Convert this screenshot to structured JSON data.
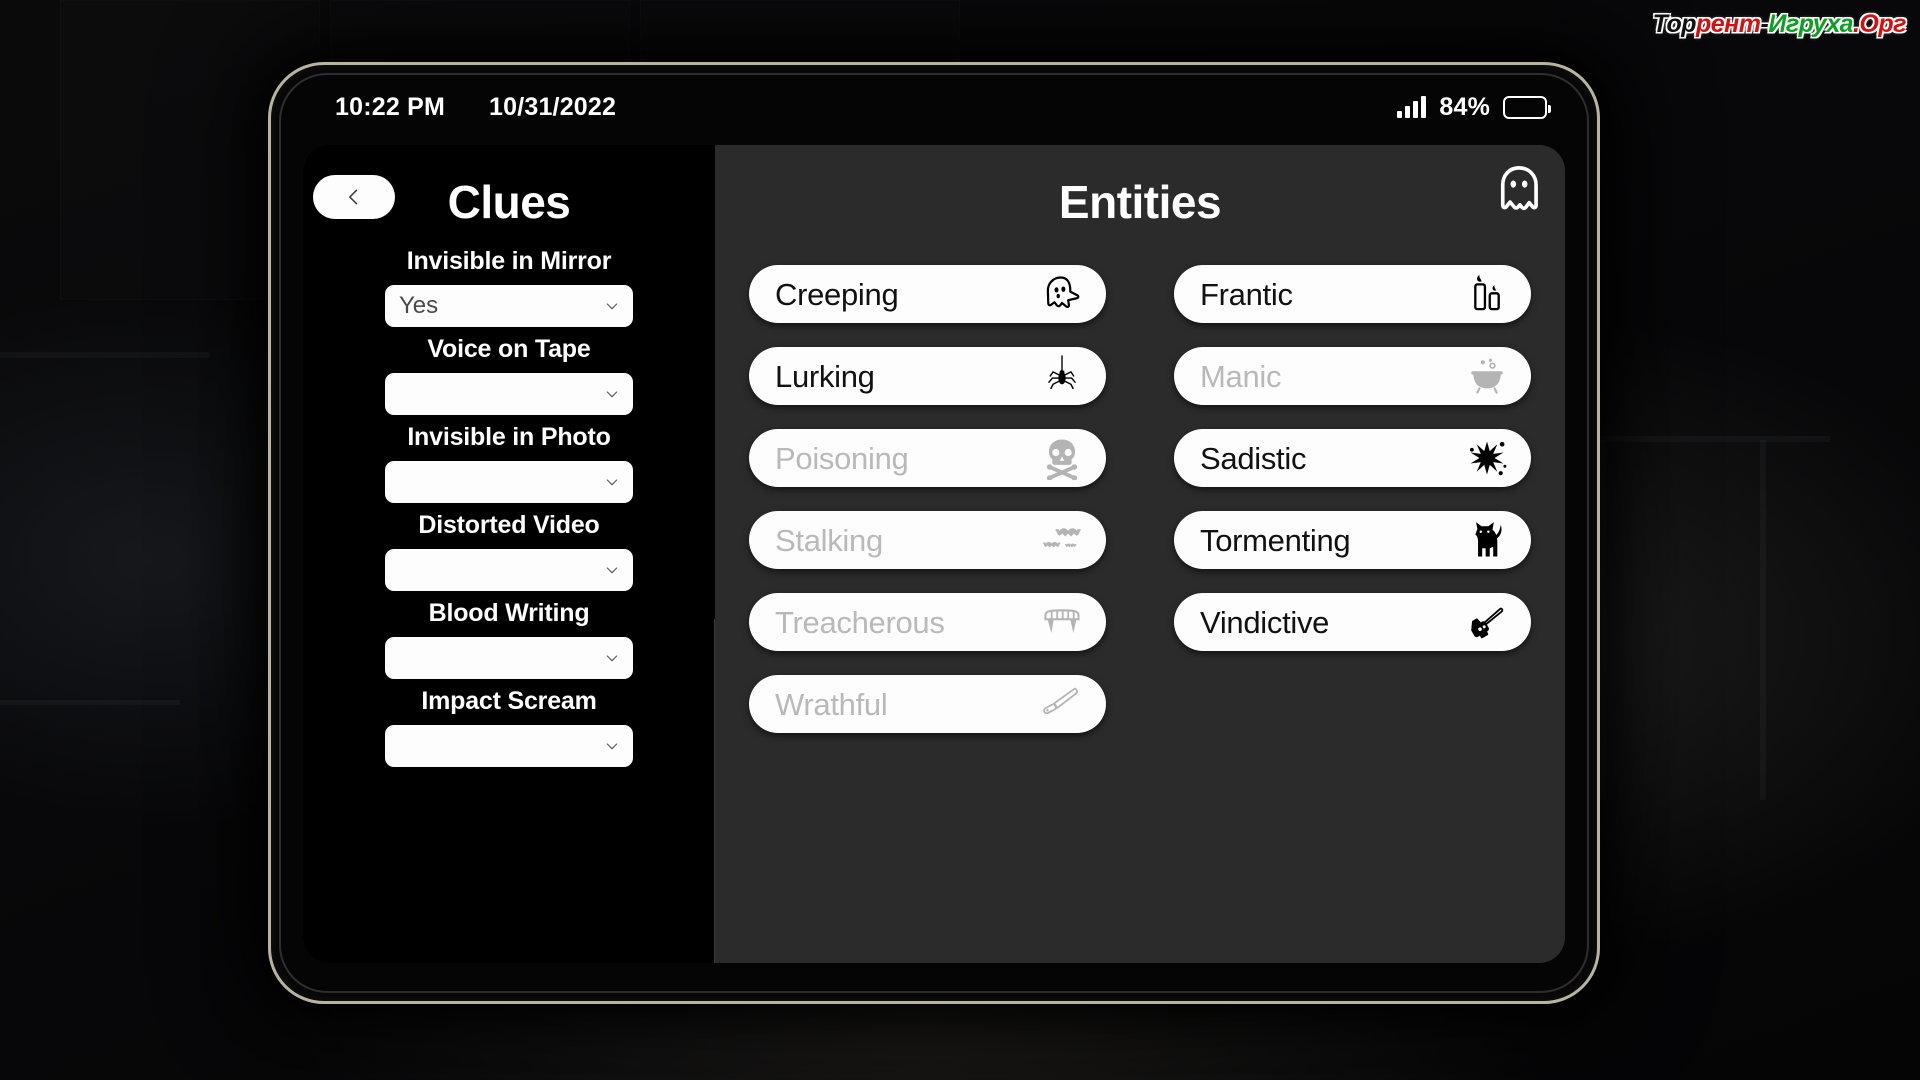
{
  "watermark": {
    "part1": "Тор",
    "part2": "рент",
    "part3": "-",
    "part4": "Игруха",
    "part5": ".Орг"
  },
  "status_bar": {
    "time": "10:22 PM",
    "date": "10/31/2022",
    "battery_percent": "84%",
    "signal_icon": "signal-bars-icon",
    "battery_icon": "battery-icon"
  },
  "clues": {
    "title": "Clues",
    "back_icon": "chevron-left-icon",
    "items": [
      {
        "label": "Invisible in Mirror",
        "value": "Yes"
      },
      {
        "label": "Voice on Tape",
        "value": ""
      },
      {
        "label": "Invisible in Photo",
        "value": ""
      },
      {
        "label": "Distorted Video",
        "value": ""
      },
      {
        "label": "Blood Writing",
        "value": ""
      },
      {
        "label": "Impact Scream",
        "value": ""
      }
    ]
  },
  "entities": {
    "title": "Entities",
    "badge_icon": "ghost-icon",
    "items": [
      {
        "name": "Creeping",
        "icon": "ghost-icon",
        "enabled": true
      },
      {
        "name": "Frantic",
        "icon": "candles-icon",
        "enabled": true
      },
      {
        "name": "Lurking",
        "icon": "spider-icon",
        "enabled": true
      },
      {
        "name": "Manic",
        "icon": "cauldron-icon",
        "enabled": false
      },
      {
        "name": "Poisoning",
        "icon": "skull-crossbones-icon",
        "enabled": false
      },
      {
        "name": "Sadistic",
        "icon": "blood-splatter-icon",
        "enabled": true
      },
      {
        "name": "Stalking",
        "icon": "bats-icon",
        "enabled": false
      },
      {
        "name": "Tormenting",
        "icon": "black-cat-icon",
        "enabled": true
      },
      {
        "name": "Treacherous",
        "icon": "fangs-icon",
        "enabled": false
      },
      {
        "name": "Vindictive",
        "icon": "chainsaw-icon",
        "enabled": true
      },
      {
        "name": "Wrathful",
        "icon": "knife-icon",
        "enabled": false
      }
    ]
  },
  "colors": {
    "tablet_frame": "#b9b4a0",
    "clues_bg": "#000000",
    "entities_bg": "#2b2b2b",
    "button_bg": "#fdfdfd",
    "disabled_text": "#b9b9b9"
  }
}
